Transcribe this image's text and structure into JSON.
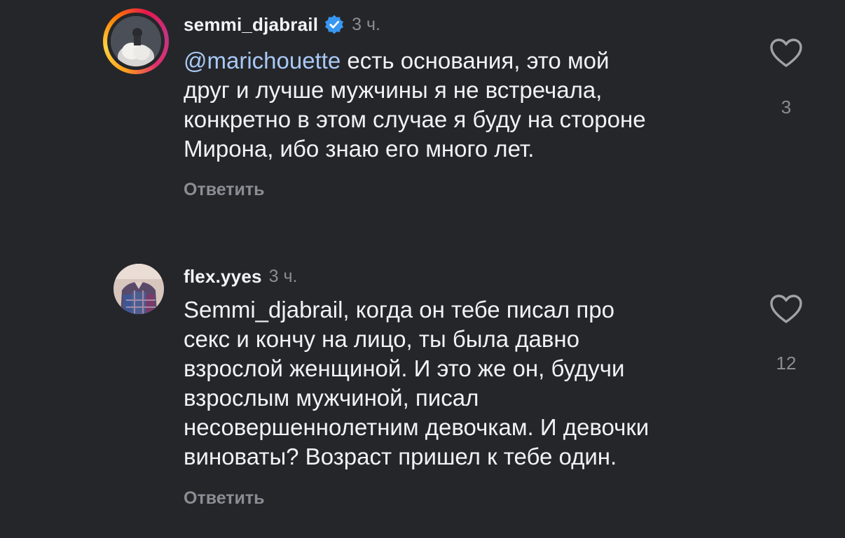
{
  "comments": [
    {
      "username": "semmi_djabrail",
      "verified": true,
      "time": "3 ч.",
      "mention": "@marichouette",
      "lines": [
        " есть основания, это мой",
        "друг и лучше мужчины я не встречала,",
        "конкретно в этом случае я буду на стороне",
        "Мирона, ибо знаю его много лет."
      ],
      "reply_label": "Ответить",
      "like_count": "3",
      "avatar_story_ring": true
    },
    {
      "username": "flex.yyes",
      "verified": false,
      "time": "3 ч.",
      "lines": [
        "Semmi_djabrail, когда он тебе писал про",
        "секс и кончу на лицо, ты была давно",
        "взрослой женщиной. И это же он, будучи",
        "взрослым мужчиной, писал",
        "несовершеннолетним девочкам. И девочки",
        "виноваты? Возраст пришел к тебе один."
      ],
      "reply_label": "Ответить",
      "like_count": "12",
      "avatar_story_ring": false
    }
  ],
  "icons": {
    "verified": "verified-badge-icon",
    "like": "heart-outline-icon"
  },
  "colors": {
    "background": "#25262a",
    "text": "#f2f2f4",
    "muted": "#8b8d94",
    "mention": "#a8c9f5",
    "verified": "#3897f0"
  }
}
